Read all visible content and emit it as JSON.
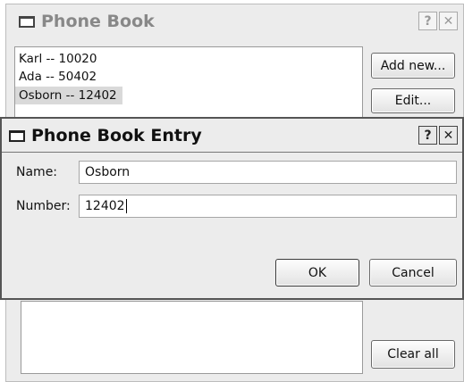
{
  "phonebook": {
    "title": "Phone Book",
    "help_label": "?",
    "close_label": "✕",
    "entries": [
      "Karl -- 10020",
      "Ada -- 50402",
      "Osborn -- 12402"
    ],
    "selected_index": 2,
    "add_new_label": "Add new...",
    "edit_label": "Edit...",
    "clear_all_label": "Clear all"
  },
  "dialog": {
    "title": "Phone Book Entry",
    "help_label": "?",
    "close_label": "✕",
    "name_label": "Name:",
    "name_value": "Osborn",
    "number_label": "Number:",
    "number_value": "12402",
    "ok_label": "OK",
    "cancel_label": "Cancel"
  },
  "colors": {
    "window_bg": "#ececec",
    "inactive_title": "#8a8a8a",
    "active_title": "#111111"
  }
}
